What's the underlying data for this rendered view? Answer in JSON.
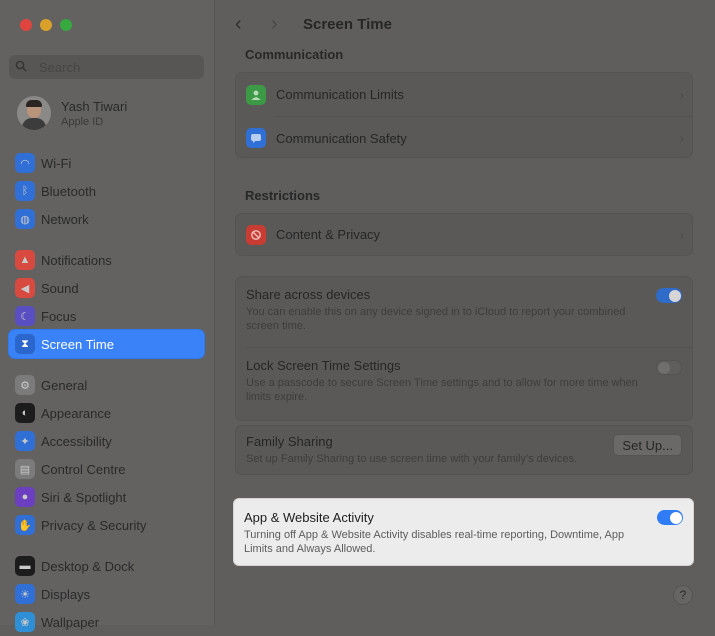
{
  "search": {
    "placeholder": "Search"
  },
  "profile": {
    "name": "Yash Tiwari",
    "subtitle": "Apple ID"
  },
  "sidebar": {
    "group1": [
      {
        "label": "Wi-Fi",
        "icon": "wifi-icon",
        "color": "#2f6fd6"
      },
      {
        "label": "Bluetooth",
        "icon": "bluetooth-icon",
        "color": "#2f6fd6"
      },
      {
        "label": "Network",
        "icon": "globe-icon",
        "color": "#2f6fd6"
      }
    ],
    "group2": [
      {
        "label": "Notifications",
        "icon": "bell-icon",
        "color": "#d84a3f"
      },
      {
        "label": "Sound",
        "icon": "speaker-icon",
        "color": "#d84a3f"
      },
      {
        "label": "Focus",
        "icon": "moon-icon",
        "color": "#5a4fc2"
      },
      {
        "label": "Screen Time",
        "icon": "hourglass-icon",
        "color": "#5a4fc2",
        "selected": true
      }
    ],
    "group3": [
      {
        "label": "General",
        "icon": "gear-icon",
        "color": "#7b7b7b"
      },
      {
        "label": "Appearance",
        "icon": "appearance-icon",
        "color": "#1c1c1c"
      },
      {
        "label": "Accessibility",
        "icon": "accessibility-icon",
        "color": "#2f6fd6"
      },
      {
        "label": "Control Centre",
        "icon": "control-centre-icon",
        "color": "#7b7b7b"
      },
      {
        "label": "Siri & Spotlight",
        "icon": "siri-icon",
        "color": "#6b3fbf"
      },
      {
        "label": "Privacy & Security",
        "icon": "hand-icon",
        "color": "#2f6fd6"
      }
    ],
    "group4": [
      {
        "label": "Desktop & Dock",
        "icon": "dock-icon",
        "color": "#1c1c1c"
      },
      {
        "label": "Displays",
        "icon": "display-icon",
        "color": "#2f6fd6"
      },
      {
        "label": "Wallpaper",
        "icon": "wallpaper-icon",
        "color": "#2f8fd6"
      }
    ]
  },
  "header": {
    "title": "Screen Time",
    "back": "‹",
    "forward": "›"
  },
  "communication": {
    "section": "Communication",
    "rows": [
      {
        "label": "Communication Limits",
        "icon": "communication-limits-icon",
        "color": "#3c9a47"
      },
      {
        "label": "Communication Safety",
        "icon": "communication-safety-icon",
        "color": "#2f6fd6"
      }
    ]
  },
  "restrictions": {
    "section": "Restrictions",
    "rows": [
      {
        "label": "Content & Privacy",
        "icon": "restriction-icon",
        "color": "#c73c33"
      }
    ]
  },
  "settings": {
    "share": {
      "title": "Share across devices",
      "desc": "You can enable this on any device signed in to iCloud to report your combined screen time.",
      "on": true
    },
    "lock": {
      "title": "Lock Screen Time Settings",
      "desc": "Use a passcode to secure Screen Time settings and to allow for more time when limits expire.",
      "on": false
    },
    "family": {
      "title": "Family Sharing",
      "desc": "Set up Family Sharing to use screen time with your family's devices.",
      "button": "Set Up..."
    },
    "activity": {
      "title": "App & Website Activity",
      "desc": "Turning off App & Website Activity disables real-time reporting, Downtime, App Limits and Always Allowed.",
      "on": true
    }
  },
  "help": "?"
}
